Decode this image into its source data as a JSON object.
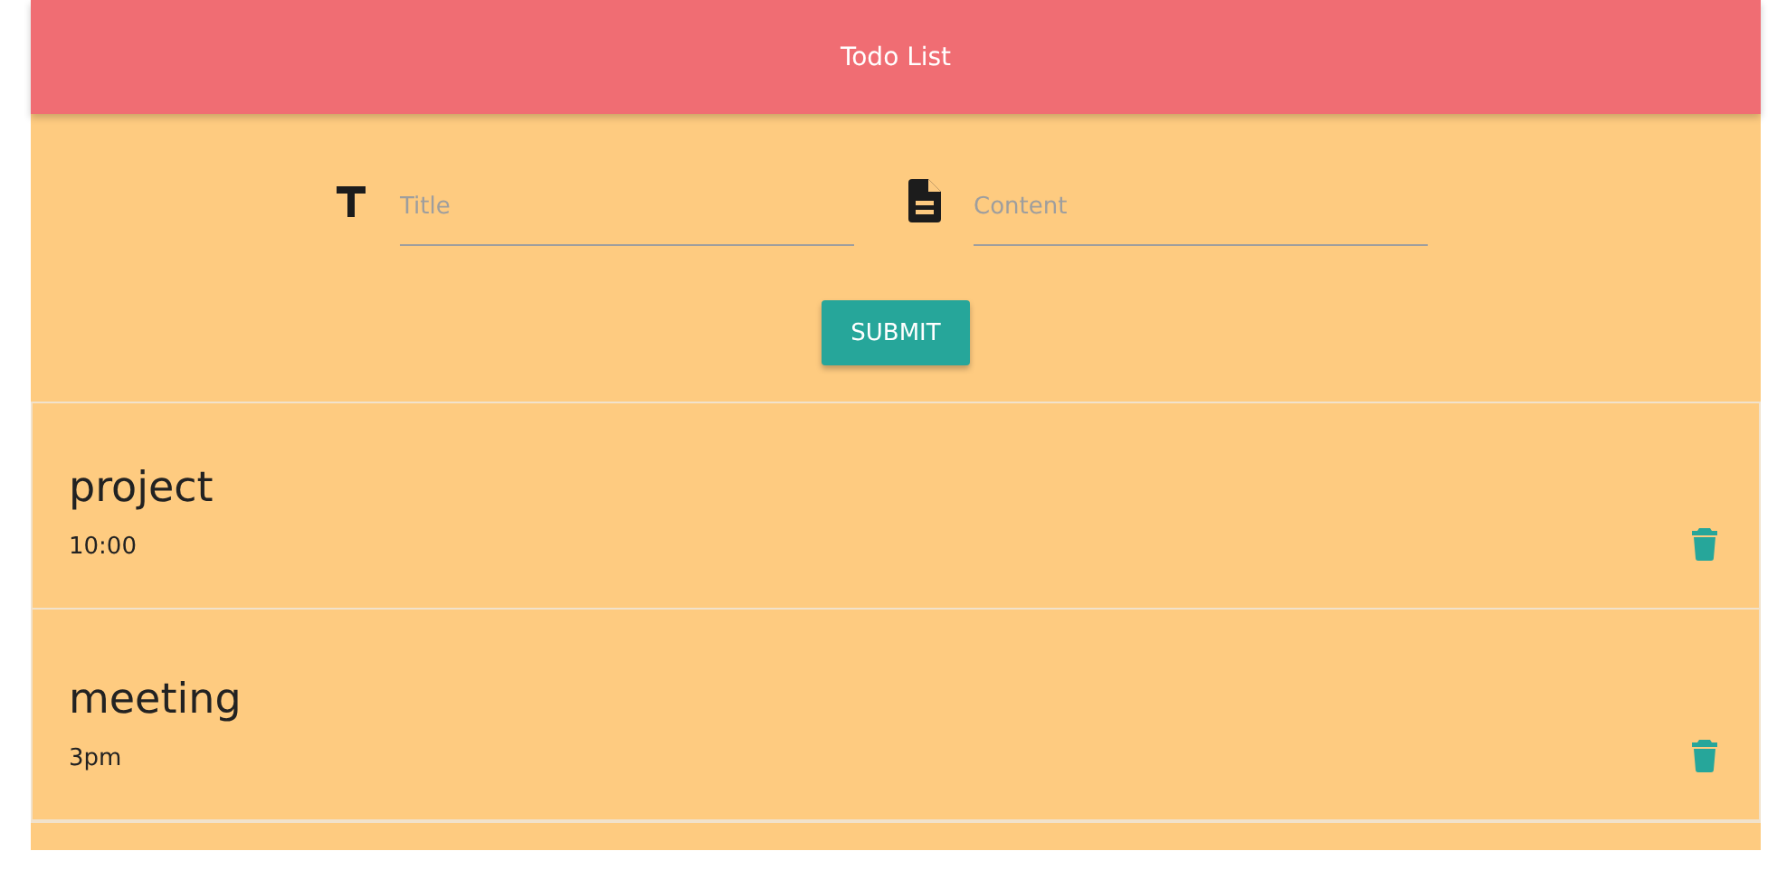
{
  "header": {
    "title": "Todo List"
  },
  "form": {
    "fields": [
      {
        "kind": "title",
        "placeholder": "Title"
      },
      {
        "kind": "content",
        "placeholder": "Content"
      }
    ],
    "submit": "SUBMIT"
  },
  "todos": [
    {
      "title": "project",
      "content": "10:00"
    },
    {
      "title": "meeting",
      "content": "3pm"
    }
  ]
}
